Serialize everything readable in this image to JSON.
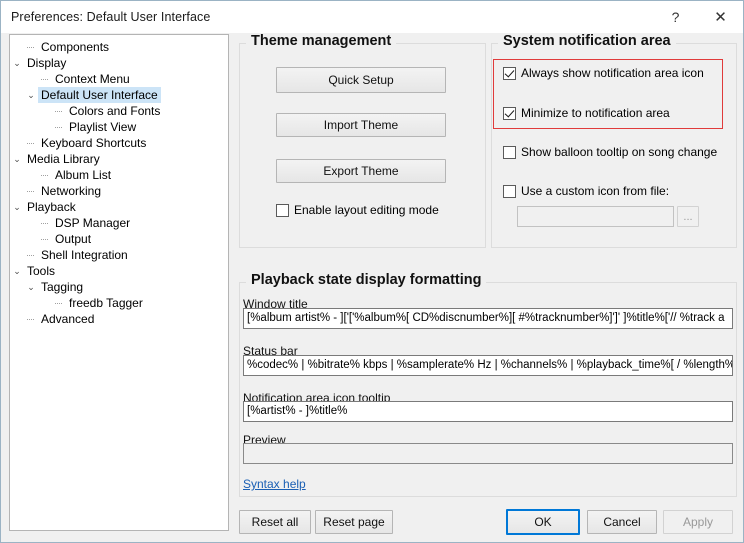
{
  "window": {
    "title": "Preferences: Default User Interface",
    "help_icon": "?",
    "close_icon": "✕"
  },
  "tree": {
    "items": [
      {
        "label": "Components",
        "depth": 1,
        "expander": "",
        "selected": false
      },
      {
        "label": "Display",
        "depth": 0,
        "expander": "⌄",
        "selected": false
      },
      {
        "label": "Context Menu",
        "depth": 2,
        "expander": "",
        "selected": false
      },
      {
        "label": "Default User Interface",
        "depth": 1,
        "expander": "⌄",
        "selected": true
      },
      {
        "label": "Colors and Fonts",
        "depth": 3,
        "expander": "",
        "selected": false
      },
      {
        "label": "Playlist View",
        "depth": 3,
        "expander": "",
        "selected": false
      },
      {
        "label": "Keyboard Shortcuts",
        "depth": 1,
        "expander": "",
        "selected": false
      },
      {
        "label": "Media Library",
        "depth": 0,
        "expander": "⌄",
        "selected": false
      },
      {
        "label": "Album List",
        "depth": 2,
        "expander": "",
        "selected": false
      },
      {
        "label": "Networking",
        "depth": 1,
        "expander": "",
        "selected": false
      },
      {
        "label": "Playback",
        "depth": 0,
        "expander": "⌄",
        "selected": false
      },
      {
        "label": "DSP Manager",
        "depth": 2,
        "expander": "",
        "selected": false
      },
      {
        "label": "Output",
        "depth": 2,
        "expander": "",
        "selected": false
      },
      {
        "label": "Shell Integration",
        "depth": 1,
        "expander": "",
        "selected": false
      },
      {
        "label": "Tools",
        "depth": 0,
        "expander": "⌄",
        "selected": false
      },
      {
        "label": "Tagging",
        "depth": 1,
        "expander": "⌄",
        "selected": false
      },
      {
        "label": "freedb Tagger",
        "depth": 3,
        "expander": "",
        "selected": false
      },
      {
        "label": "Advanced",
        "depth": 1,
        "expander": "",
        "selected": false
      }
    ]
  },
  "theme_management": {
    "title": "Theme management",
    "quick_setup": "Quick Setup",
    "import_theme": "Import Theme",
    "export_theme": "Export Theme",
    "enable_layout_editing": "Enable layout editing mode",
    "enable_layout_editing_checked": false
  },
  "notification_area": {
    "title": "System notification area",
    "always_show": "Always show notification area icon",
    "always_show_checked": true,
    "minimize_to": "Minimize to notification area",
    "minimize_to_checked": true,
    "show_balloon": "Show balloon tooltip on song change",
    "show_balloon_checked": false,
    "use_custom_icon": "Use a custom icon from file:",
    "use_custom_icon_checked": false,
    "icon_path_value": "",
    "browse_label": "...",
    "highlight_color": "#e03b3b"
  },
  "formatting": {
    "title": "Playback state display formatting",
    "window_title_label": "Window title",
    "window_title_value": "[%album artist% - ]['['%album%[ CD%discnumber%][ #%tracknumber%]']' ]%title%['// %track a",
    "status_bar_label": "Status bar",
    "status_bar_value": "%codec% | %bitrate% kbps | %samplerate% Hz | %channels% | %playback_time%[ / %length%",
    "tooltip_label": "Notification area icon tooltip",
    "tooltip_value": "[%artist% - ]%title%",
    "preview_label": "Preview",
    "preview_value": "",
    "syntax_help": "Syntax help"
  },
  "footer": {
    "reset_all": "Reset all",
    "reset_page": "Reset page",
    "ok": "OK",
    "cancel": "Cancel",
    "apply": "Apply",
    "apply_disabled": true
  }
}
